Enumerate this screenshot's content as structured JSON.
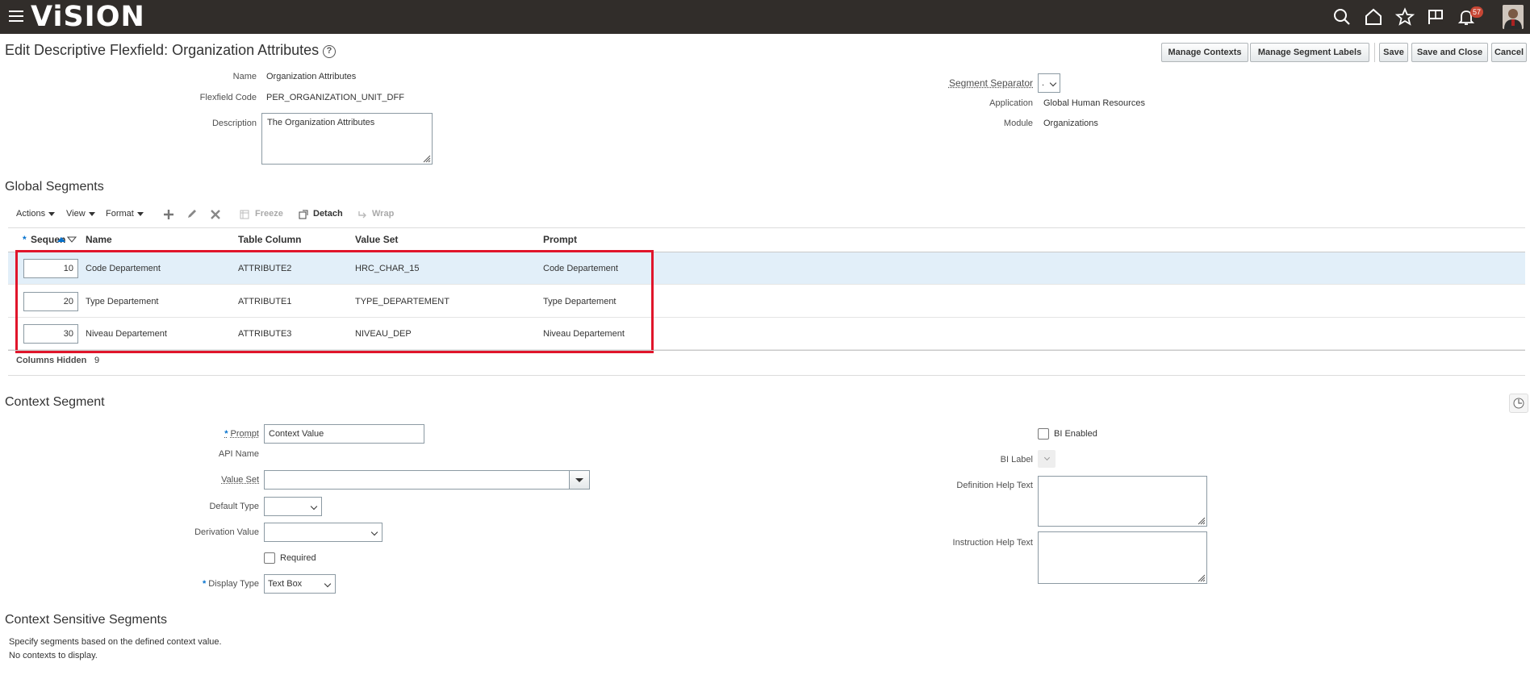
{
  "brand": {
    "logo_text": "ViSION"
  },
  "header": {
    "notification_count": "57"
  },
  "page": {
    "title": "Edit Descriptive Flexfield: Organization Attributes"
  },
  "actions": {
    "manage_contexts": "Manage Contexts",
    "manage_segment_labels": "Manage Segment Labels",
    "save": "Save",
    "save_and_close": "Save and Close",
    "cancel": "Cancel"
  },
  "flexfield": {
    "name_label": "Name",
    "name_value": "Organization Attributes",
    "code_label": "Flexfield Code",
    "code_value": "PER_ORGANIZATION_UNIT_DFF",
    "description_label": "Description",
    "description_value": "The Organization Attributes",
    "segment_separator_label": "Segment Separator",
    "segment_separator_value": ".",
    "application_label": "Application",
    "application_value": "Global Human Resources",
    "module_label": "Module",
    "module_value": "Organizations"
  },
  "global_segments": {
    "title": "Global Segments",
    "toolbar": {
      "actions": "Actions",
      "view": "View",
      "format": "Format",
      "freeze": "Freeze",
      "detach": "Detach",
      "wrap": "Wrap"
    },
    "columns": {
      "required_marker": "*",
      "sequence": "Sequence",
      "name": "Name",
      "table_column": "Table Column",
      "value_set": "Value Set",
      "prompt": "Prompt"
    },
    "rows": [
      {
        "sequence": "10",
        "name": "Code Departement",
        "table_column": "ATTRIBUTE2",
        "value_set": "HRC_CHAR_15",
        "prompt": "Code Departement"
      },
      {
        "sequence": "20",
        "name": "Type Departement",
        "table_column": "ATTRIBUTE1",
        "value_set": "TYPE_DEPARTEMENT",
        "prompt": "Type Departement"
      },
      {
        "sequence": "30",
        "name": "Niveau Departement",
        "table_column": "ATTRIBUTE3",
        "value_set": "NIVEAU_DEP",
        "prompt": "Niveau Departement"
      }
    ],
    "columns_hidden_label": "Columns Hidden",
    "columns_hidden_count": "9"
  },
  "context_segment": {
    "title": "Context Segment",
    "required_marker": "*",
    "prompt_label": "Prompt",
    "prompt_value": "Context Value",
    "api_name_label": "API Name",
    "value_set_label": "Value Set",
    "default_type_label": "Default Type",
    "derivation_value_label": "Derivation Value",
    "required_label": "Required",
    "display_type_label": "Display Type",
    "display_type_value": "Text Box",
    "bi_enabled_label": "BI Enabled",
    "bi_label_label": "BI Label",
    "definition_help_label": "Definition Help Text",
    "instruction_help_label": "Instruction Help Text"
  },
  "context_sensitive": {
    "title": "Context Sensitive Segments",
    "line1": "Specify segments based on the defined context value.",
    "line2": "No contexts to display."
  }
}
